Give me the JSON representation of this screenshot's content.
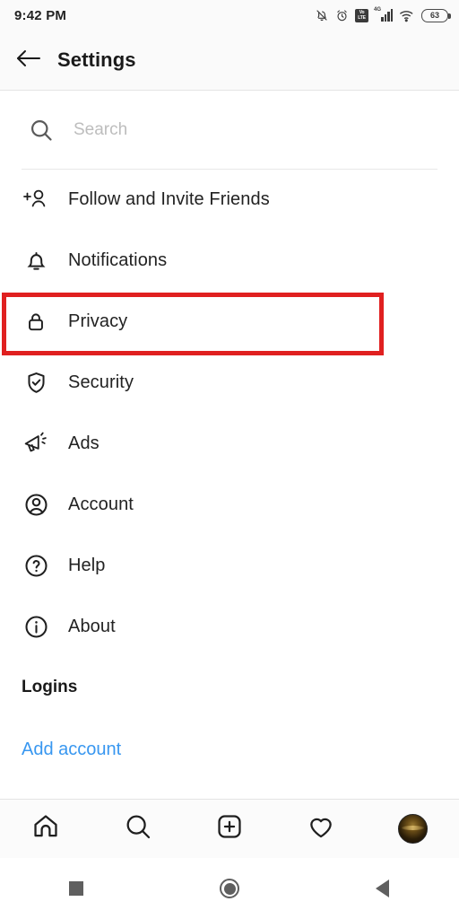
{
  "status_bar": {
    "time": "9:42 PM",
    "battery_level": "63",
    "icons": [
      "notifications-off-icon",
      "alarm-icon",
      "volte-icon",
      "signal-4g-icon",
      "wifi-icon",
      "battery-icon"
    ],
    "network_label": "4G",
    "network_sub": "LTE",
    "volte_top": "Vo",
    "volte_bottom": "LTE"
  },
  "header": {
    "title": "Settings",
    "back_icon": "arrow-left-icon"
  },
  "search": {
    "placeholder": "Search",
    "value": "",
    "icon": "search-icon"
  },
  "menu": {
    "items": [
      {
        "label": "Follow and Invite Friends",
        "icon": "person-add-icon",
        "highlighted": false
      },
      {
        "label": "Notifications",
        "icon": "bell-icon",
        "highlighted": false
      },
      {
        "label": "Privacy",
        "icon": "lock-icon",
        "highlighted": true
      },
      {
        "label": "Security",
        "icon": "shield-check-icon",
        "highlighted": false
      },
      {
        "label": "Ads",
        "icon": "megaphone-icon",
        "highlighted": false
      },
      {
        "label": "Account",
        "icon": "account-circle-icon",
        "highlighted": false
      },
      {
        "label": "Help",
        "icon": "question-circle-icon",
        "highlighted": false
      },
      {
        "label": "About",
        "icon": "info-circle-icon",
        "highlighted": false
      }
    ]
  },
  "logins": {
    "section_title": "Logins",
    "add_account_label": "Add account"
  },
  "tabbar": {
    "items": [
      {
        "name": "home",
        "icon": "home-icon"
      },
      {
        "name": "search",
        "icon": "search-icon"
      },
      {
        "name": "create",
        "icon": "plus-square-icon"
      },
      {
        "name": "activity",
        "icon": "heart-icon"
      },
      {
        "name": "profile",
        "icon": "avatar-icon"
      }
    ]
  },
  "android_nav": {
    "items": [
      {
        "name": "recents",
        "icon": "square-icon"
      },
      {
        "name": "home",
        "icon": "circle-icon"
      },
      {
        "name": "back",
        "icon": "triangle-left-icon"
      }
    ]
  },
  "colors": {
    "highlight": "#e02020",
    "link": "#3897f0",
    "header_bg": "#fafafa",
    "text": "#222222"
  }
}
